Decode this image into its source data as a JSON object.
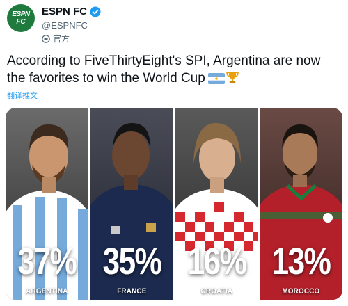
{
  "account": {
    "logo_line1": "ESPN",
    "logo_line2": "FC",
    "display_name": "ESPN FC",
    "handle": "@ESPNFC",
    "official_label": "官方"
  },
  "tweet": {
    "text": "According to FiveThirtyEight's SPI, Argentina are now the favorites to win the World Cup",
    "translate_label": "翻译推文"
  },
  "media": {
    "panels": [
      {
        "percent": "37%",
        "team": "ARGENTINA",
        "value": 37
      },
      {
        "percent": "35%",
        "team": "FRANCE",
        "value": 35
      },
      {
        "percent": "16%",
        "team": "CROATIA",
        "value": 16
      },
      {
        "percent": "13%",
        "team": "MOROCCO",
        "value": 13
      }
    ]
  },
  "colors": {
    "espn_green": "#1f7a3d",
    "verified_blue": "#1d9bf0",
    "link_blue": "#1d9bf0",
    "argentina_blue": "#75aadb",
    "france_navy": "#1b2a4e",
    "croatia_red": "#d6282f",
    "morocco_red": "#b3202a"
  },
  "icons": [
    "verified-badge-icon",
    "official-badge-icon",
    "argentina-flag-icon",
    "trophy-icon"
  ]
}
